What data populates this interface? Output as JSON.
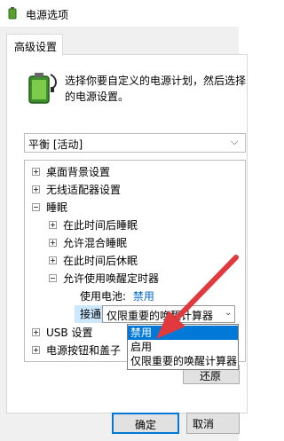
{
  "window": {
    "title": "电源选项"
  },
  "tabs": [
    {
      "label": "高级设置"
    }
  ],
  "description": {
    "line1": "选择你要自定义的电源计划，然后选择",
    "line2": "的电源设置。"
  },
  "plan": {
    "selected": "平衡 [活动]"
  },
  "tree": {
    "desktop_background": "桌面背景设置",
    "wireless_adapter": "无线适配器设置",
    "sleep": "睡眠",
    "sleep_after": "在此时间后睡眠",
    "hybrid_sleep": "允许混合睡眠",
    "hibernate_after": "在此时间后休眠",
    "wake_timers": "允许使用唤醒定时器",
    "on_battery_label": "使用电池:",
    "on_battery_value": "禁用",
    "plugged_in_label": "接通电源:",
    "plugged_in_value": "仅限重要的唤醒计算器",
    "usb": "USB 设置",
    "power_buttons": "电源按钮和盖子"
  },
  "dropdown": {
    "options": [
      "禁用",
      "启用",
      "仅限重要的唤醒计算器"
    ],
    "selected_index": 0
  },
  "buttons": {
    "restore": "还原",
    "ok": "确定",
    "cancel": "取消"
  },
  "colors": {
    "accent": "#0078d7",
    "annotation_arrow": "#e0393e",
    "link": "#0066cc"
  }
}
